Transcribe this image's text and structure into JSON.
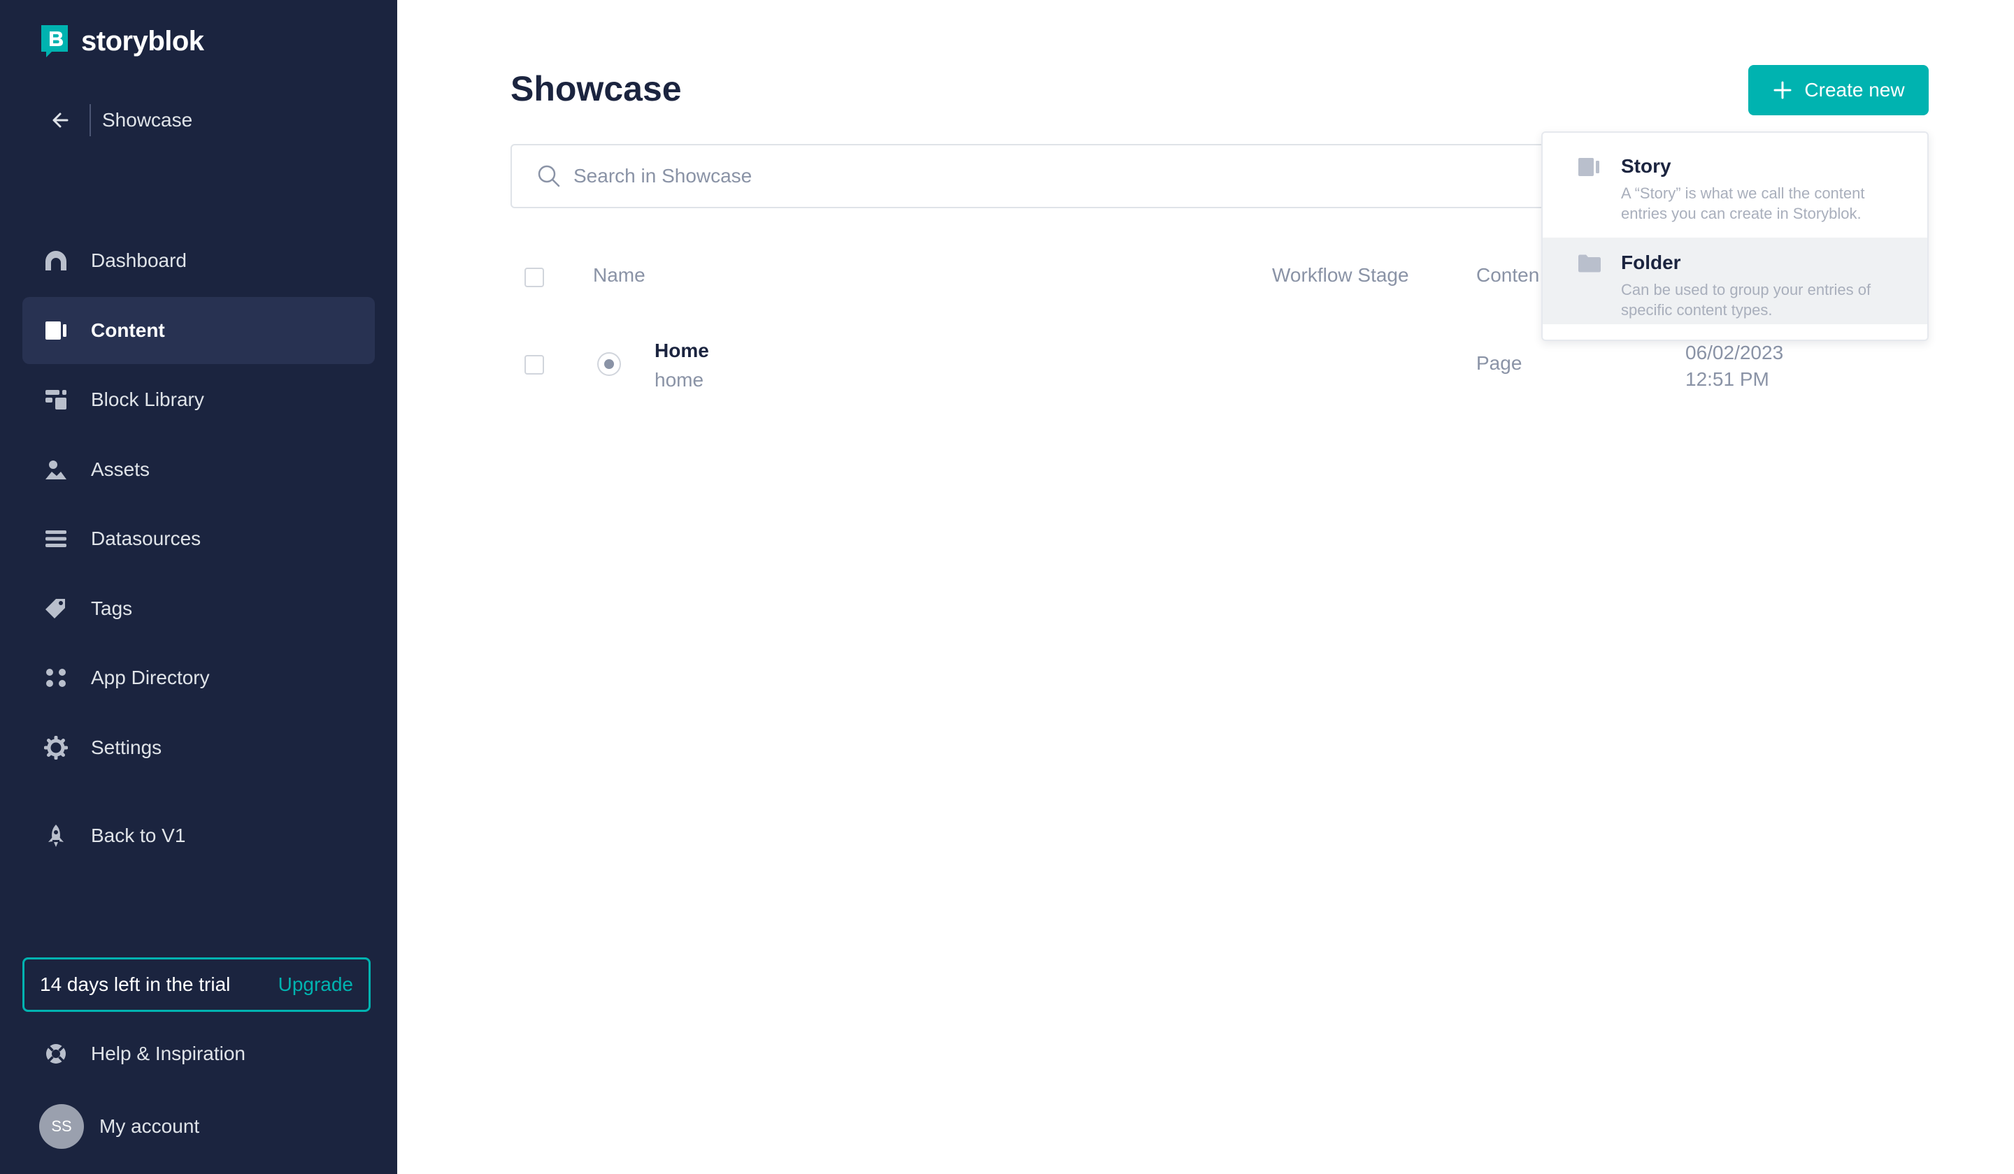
{
  "app": {
    "name": "storyblok"
  },
  "sidebar": {
    "space_name": "Showcase",
    "items": [
      {
        "label": "Dashboard",
        "icon": "dashboard-icon"
      },
      {
        "label": "Content",
        "icon": "content-icon",
        "active": true
      },
      {
        "label": "Block Library",
        "icon": "block-library-icon"
      },
      {
        "label": "Assets",
        "icon": "assets-icon"
      },
      {
        "label": "Datasources",
        "icon": "datasources-icon"
      },
      {
        "label": "Tags",
        "icon": "tag-icon"
      },
      {
        "label": "App Directory",
        "icon": "apps-icon"
      },
      {
        "label": "Settings",
        "icon": "gear-icon"
      }
    ],
    "back_label": "Back to V1",
    "trial_text": "14 days left in the trial",
    "upgrade_label": "Upgrade",
    "help_label": "Help & Inspiration",
    "account": {
      "initials": "SS",
      "label": "My account"
    }
  },
  "main": {
    "title": "Showcase",
    "create_label": "Create new",
    "search_placeholder": "Search in Showcase",
    "columns": [
      "Name",
      "Workflow Stage",
      "Conten"
    ],
    "rows": [
      {
        "name": "Home",
        "slug": "home",
        "content_type": "Page",
        "date": "06/02/2023",
        "time": "12:51 PM"
      }
    ]
  },
  "dropdown": {
    "items": [
      {
        "title": "Story",
        "description": "A “Story” is what we call the content entries you can create in Storyblok."
      },
      {
        "title": "Folder",
        "description": "Can be used to group your entries of specific content types."
      }
    ]
  },
  "colors": {
    "sidebar_bg": "#1b243f",
    "accent": "#00b3b0",
    "active_item_bg": "#283252"
  }
}
